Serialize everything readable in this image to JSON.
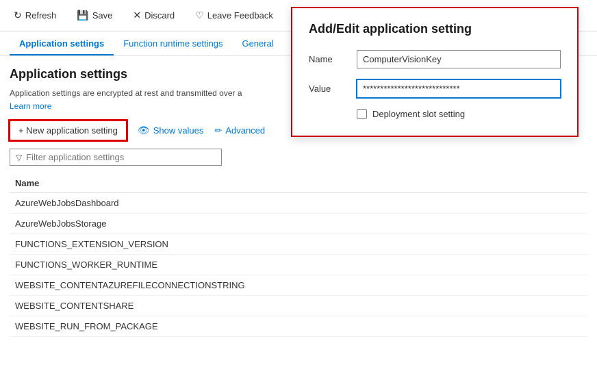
{
  "toolbar": {
    "refresh_label": "Refresh",
    "save_label": "Save",
    "discard_label": "Discard",
    "feedback_label": "Leave Feedback"
  },
  "tabs": {
    "items": [
      {
        "id": "app-settings",
        "label": "Application settings",
        "active": true
      },
      {
        "id": "function-runtime",
        "label": "Function runtime settings",
        "active": false
      },
      {
        "id": "general",
        "label": "General",
        "active": false
      }
    ]
  },
  "page": {
    "title": "Application settings",
    "description": "Application settings are encrypted at rest and transmitted over a",
    "learn_more": "Learn more"
  },
  "action_bar": {
    "new_setting_label": "+ New application setting",
    "show_values_label": "Show values",
    "advanced_label": "Advanced"
  },
  "filter": {
    "placeholder": "Filter application settings",
    "label": "Filter application settings"
  },
  "table": {
    "headers": [
      {
        "id": "name",
        "label": "Name"
      }
    ],
    "rows": [
      {
        "name": "AzureWebJobsDashboard"
      },
      {
        "name": "AzureWebJobsStorage"
      },
      {
        "name": "FUNCTIONS_EXTENSION_VERSION"
      },
      {
        "name": "FUNCTIONS_WORKER_RUNTIME"
      },
      {
        "name": "WEBSITE_CONTENTAZUREFILECONNECTIONSTRING"
      },
      {
        "name": "WEBSITE_CONTENTSHARE"
      },
      {
        "name": "WEBSITE_RUN_FROM_PACKAGE"
      }
    ]
  },
  "panel": {
    "title": "Add/Edit application setting",
    "name_label": "Name",
    "name_value": "ComputerVisionKey",
    "value_label": "Value",
    "value_placeholder": "****************************",
    "deployment_slot_label": "Deployment slot setting"
  }
}
